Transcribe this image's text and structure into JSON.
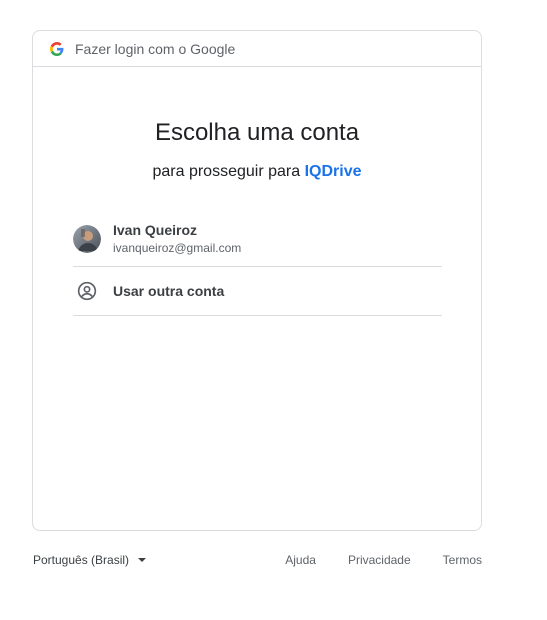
{
  "header": {
    "text": "Fazer login com o Google"
  },
  "main": {
    "title": "Escolha uma conta",
    "subtitle_prefix": "para prosseguir para",
    "app_name": "IQDrive"
  },
  "accounts": [
    {
      "name": "Ivan Queiroz",
      "email": "ivanqueiroz@gmail.com"
    }
  ],
  "other_account_label": "Usar outra conta",
  "footer": {
    "language": "Português (Brasil)",
    "links": [
      "Ajuda",
      "Privacidade",
      "Termos"
    ]
  },
  "colors": {
    "accent": "#1a73e8",
    "border": "#dadce0"
  },
  "icons": [
    "google-logo-icon",
    "avatar",
    "person-circle-icon",
    "chevron-down-icon"
  ]
}
